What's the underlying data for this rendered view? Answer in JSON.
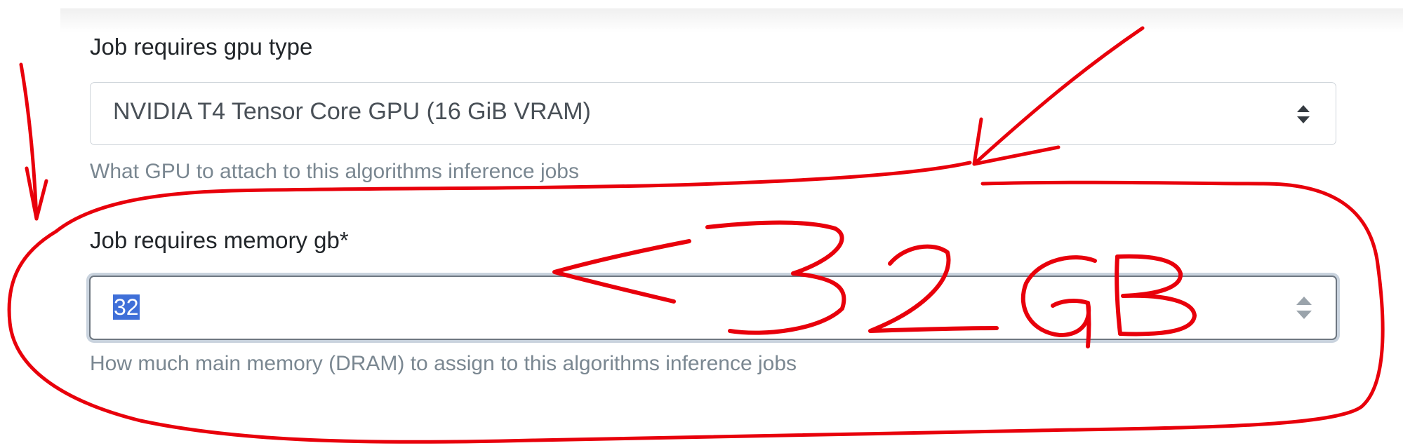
{
  "gpu_field": {
    "label": "Job requires gpu type",
    "selected_value": "NVIDIA T4 Tensor Core GPU (16 GiB VRAM)",
    "help_text": "What GPU to attach to this algorithms inference jobs"
  },
  "memory_field": {
    "label": "Job requires memory gb*",
    "value": "32",
    "help_text": "How much main memory (DRAM) to assign to this algorithms inference jobs"
  },
  "annotation": {
    "text": "<32GB",
    "color": "#e8000b"
  },
  "colors": {
    "label_text": "#212529",
    "help_text": "#7a8791",
    "input_border": "#ced4da",
    "focus_ring": "#c9d3de",
    "text_selection": "#3f6fd8"
  }
}
